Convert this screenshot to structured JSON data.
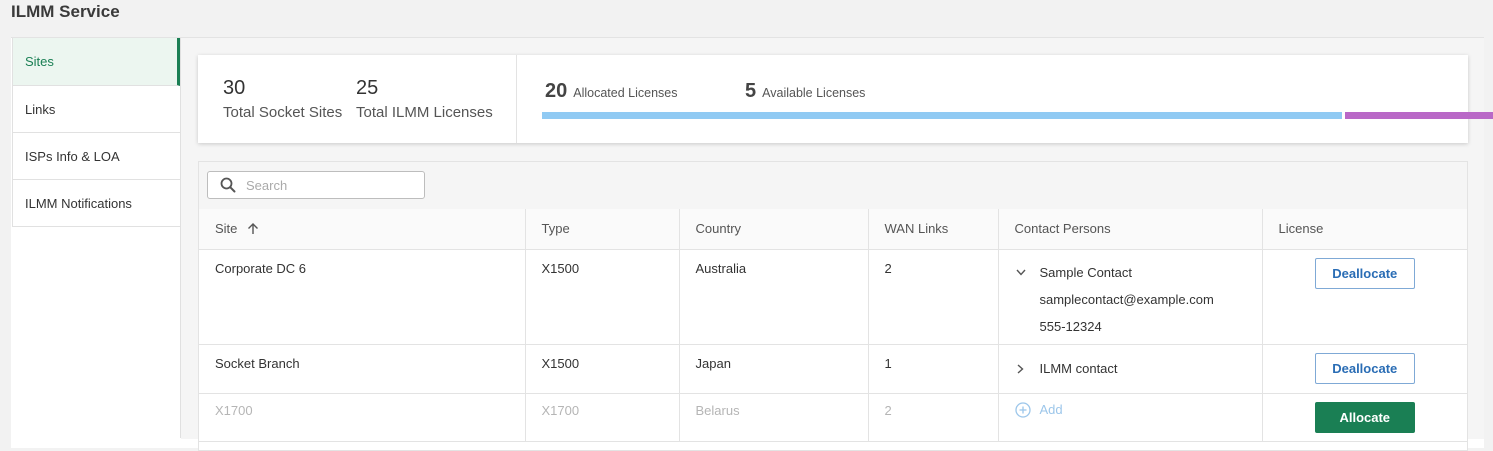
{
  "app": {
    "title": "ILMM Service"
  },
  "sidebar": {
    "items": [
      {
        "label": "Sites"
      },
      {
        "label": "Links"
      },
      {
        "label": "ISPs Info & LOA"
      },
      {
        "label": "ILMM Notifications"
      }
    ],
    "active_index": 0
  },
  "stats": {
    "total_socket_sites": {
      "value": "30",
      "label": "Total Socket Sites"
    },
    "total_ilmm_licenses": {
      "value": "25",
      "label": "Total ILMM Licenses"
    },
    "allocated": {
      "value": "20",
      "label": "Allocated Licenses",
      "color": "#90caf3",
      "fraction": 0.8
    },
    "available": {
      "value": "5",
      "label": "Available Licenses",
      "color": "#b968c7",
      "fraction": 0.2
    }
  },
  "search": {
    "placeholder": "Search",
    "value": ""
  },
  "table": {
    "columns": {
      "site": "Site",
      "type": "Type",
      "country": "Country",
      "wan_links": "WAN Links",
      "contact_persons": "Contact Persons",
      "license": "License"
    },
    "rows": [
      {
        "site": "Corporate DC 6",
        "type": "X1500",
        "country": "Australia",
        "wan_links": "2",
        "contact": {
          "name": "Sample Contact",
          "email": "samplecontact@example.com",
          "phone": "555-12324",
          "expanded": true
        },
        "license_action": "Deallocate"
      },
      {
        "site": "Socket Branch",
        "type": "X1500",
        "country": "Japan",
        "wan_links": "1",
        "contact": {
          "name": "ILMM contact",
          "expanded": false
        },
        "license_action": "Deallocate"
      },
      {
        "site": "X1700",
        "type": "X1700",
        "country": "Belarus",
        "wan_links": "2",
        "contact": {
          "add_label": "Add"
        },
        "license_action": "Allocate"
      }
    ]
  },
  "colors": {
    "accent": "#1a7f54",
    "link_blue": "#2a6db5",
    "allocated_bar": "#90caf3",
    "available_bar": "#b968c7"
  }
}
